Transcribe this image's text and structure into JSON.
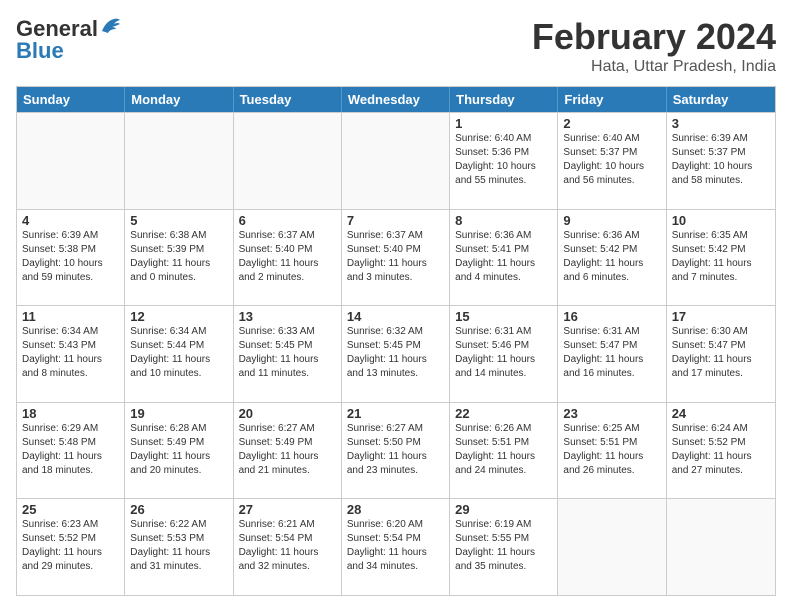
{
  "header": {
    "logo_general": "General",
    "logo_blue": "Blue",
    "main_title": "February 2024",
    "subtitle": "Hata, Uttar Pradesh, India"
  },
  "calendar": {
    "days": [
      "Sunday",
      "Monday",
      "Tuesday",
      "Wednesday",
      "Thursday",
      "Friday",
      "Saturday"
    ],
    "rows": [
      [
        {
          "date": "",
          "sunrise": "",
          "sunset": "",
          "daylight": "",
          "empty": true
        },
        {
          "date": "",
          "sunrise": "",
          "sunset": "",
          "daylight": "",
          "empty": true
        },
        {
          "date": "",
          "sunrise": "",
          "sunset": "",
          "daylight": "",
          "empty": true
        },
        {
          "date": "",
          "sunrise": "",
          "sunset": "",
          "daylight": "",
          "empty": true
        },
        {
          "date": "1",
          "sunrise": "Sunrise: 6:40 AM",
          "sunset": "Sunset: 5:36 PM",
          "daylight": "Daylight: 10 hours and 55 minutes.",
          "empty": false
        },
        {
          "date": "2",
          "sunrise": "Sunrise: 6:40 AM",
          "sunset": "Sunset: 5:37 PM",
          "daylight": "Daylight: 10 hours and 56 minutes.",
          "empty": false
        },
        {
          "date": "3",
          "sunrise": "Sunrise: 6:39 AM",
          "sunset": "Sunset: 5:37 PM",
          "daylight": "Daylight: 10 hours and 58 minutes.",
          "empty": false
        }
      ],
      [
        {
          "date": "4",
          "sunrise": "Sunrise: 6:39 AM",
          "sunset": "Sunset: 5:38 PM",
          "daylight": "Daylight: 10 hours and 59 minutes.",
          "empty": false
        },
        {
          "date": "5",
          "sunrise": "Sunrise: 6:38 AM",
          "sunset": "Sunset: 5:39 PM",
          "daylight": "Daylight: 11 hours and 0 minutes.",
          "empty": false
        },
        {
          "date": "6",
          "sunrise": "Sunrise: 6:37 AM",
          "sunset": "Sunset: 5:40 PM",
          "daylight": "Daylight: 11 hours and 2 minutes.",
          "empty": false
        },
        {
          "date": "7",
          "sunrise": "Sunrise: 6:37 AM",
          "sunset": "Sunset: 5:40 PM",
          "daylight": "Daylight: 11 hours and 3 minutes.",
          "empty": false
        },
        {
          "date": "8",
          "sunrise": "Sunrise: 6:36 AM",
          "sunset": "Sunset: 5:41 PM",
          "daylight": "Daylight: 11 hours and 4 minutes.",
          "empty": false
        },
        {
          "date": "9",
          "sunrise": "Sunrise: 6:36 AM",
          "sunset": "Sunset: 5:42 PM",
          "daylight": "Daylight: 11 hours and 6 minutes.",
          "empty": false
        },
        {
          "date": "10",
          "sunrise": "Sunrise: 6:35 AM",
          "sunset": "Sunset: 5:42 PM",
          "daylight": "Daylight: 11 hours and 7 minutes.",
          "empty": false
        }
      ],
      [
        {
          "date": "11",
          "sunrise": "Sunrise: 6:34 AM",
          "sunset": "Sunset: 5:43 PM",
          "daylight": "Daylight: 11 hours and 8 minutes.",
          "empty": false
        },
        {
          "date": "12",
          "sunrise": "Sunrise: 6:34 AM",
          "sunset": "Sunset: 5:44 PM",
          "daylight": "Daylight: 11 hours and 10 minutes.",
          "empty": false
        },
        {
          "date": "13",
          "sunrise": "Sunrise: 6:33 AM",
          "sunset": "Sunset: 5:45 PM",
          "daylight": "Daylight: 11 hours and 11 minutes.",
          "empty": false
        },
        {
          "date": "14",
          "sunrise": "Sunrise: 6:32 AM",
          "sunset": "Sunset: 5:45 PM",
          "daylight": "Daylight: 11 hours and 13 minutes.",
          "empty": false
        },
        {
          "date": "15",
          "sunrise": "Sunrise: 6:31 AM",
          "sunset": "Sunset: 5:46 PM",
          "daylight": "Daylight: 11 hours and 14 minutes.",
          "empty": false
        },
        {
          "date": "16",
          "sunrise": "Sunrise: 6:31 AM",
          "sunset": "Sunset: 5:47 PM",
          "daylight": "Daylight: 11 hours and 16 minutes.",
          "empty": false
        },
        {
          "date": "17",
          "sunrise": "Sunrise: 6:30 AM",
          "sunset": "Sunset: 5:47 PM",
          "daylight": "Daylight: 11 hours and 17 minutes.",
          "empty": false
        }
      ],
      [
        {
          "date": "18",
          "sunrise": "Sunrise: 6:29 AM",
          "sunset": "Sunset: 5:48 PM",
          "daylight": "Daylight: 11 hours and 18 minutes.",
          "empty": false
        },
        {
          "date": "19",
          "sunrise": "Sunrise: 6:28 AM",
          "sunset": "Sunset: 5:49 PM",
          "daylight": "Daylight: 11 hours and 20 minutes.",
          "empty": false
        },
        {
          "date": "20",
          "sunrise": "Sunrise: 6:27 AM",
          "sunset": "Sunset: 5:49 PM",
          "daylight": "Daylight: 11 hours and 21 minutes.",
          "empty": false
        },
        {
          "date": "21",
          "sunrise": "Sunrise: 6:27 AM",
          "sunset": "Sunset: 5:50 PM",
          "daylight": "Daylight: 11 hours and 23 minutes.",
          "empty": false
        },
        {
          "date": "22",
          "sunrise": "Sunrise: 6:26 AM",
          "sunset": "Sunset: 5:51 PM",
          "daylight": "Daylight: 11 hours and 24 minutes.",
          "empty": false
        },
        {
          "date": "23",
          "sunrise": "Sunrise: 6:25 AM",
          "sunset": "Sunset: 5:51 PM",
          "daylight": "Daylight: 11 hours and 26 minutes.",
          "empty": false
        },
        {
          "date": "24",
          "sunrise": "Sunrise: 6:24 AM",
          "sunset": "Sunset: 5:52 PM",
          "daylight": "Daylight: 11 hours and 27 minutes.",
          "empty": false
        }
      ],
      [
        {
          "date": "25",
          "sunrise": "Sunrise: 6:23 AM",
          "sunset": "Sunset: 5:52 PM",
          "daylight": "Daylight: 11 hours and 29 minutes.",
          "empty": false
        },
        {
          "date": "26",
          "sunrise": "Sunrise: 6:22 AM",
          "sunset": "Sunset: 5:53 PM",
          "daylight": "Daylight: 11 hours and 31 minutes.",
          "empty": false
        },
        {
          "date": "27",
          "sunrise": "Sunrise: 6:21 AM",
          "sunset": "Sunset: 5:54 PM",
          "daylight": "Daylight: 11 hours and 32 minutes.",
          "empty": false
        },
        {
          "date": "28",
          "sunrise": "Sunrise: 6:20 AM",
          "sunset": "Sunset: 5:54 PM",
          "daylight": "Daylight: 11 hours and 34 minutes.",
          "empty": false
        },
        {
          "date": "29",
          "sunrise": "Sunrise: 6:19 AM",
          "sunset": "Sunset: 5:55 PM",
          "daylight": "Daylight: 11 hours and 35 minutes.",
          "empty": false
        },
        {
          "date": "",
          "sunrise": "",
          "sunset": "",
          "daylight": "",
          "empty": true
        },
        {
          "date": "",
          "sunrise": "",
          "sunset": "",
          "daylight": "",
          "empty": true
        }
      ]
    ]
  }
}
